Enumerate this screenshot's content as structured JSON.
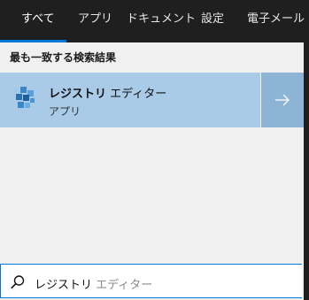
{
  "tabs": [
    {
      "label": "すべて",
      "active": true
    },
    {
      "label": "アプリ"
    },
    {
      "label": "ドキュメント"
    },
    {
      "label": "設定"
    },
    {
      "label": "電子メール"
    }
  ],
  "section_title": "最も一致する検索結果",
  "best_match": {
    "name_bold": "レジストリ",
    "name_rest": " エディター",
    "type": "アプリ",
    "icon": "registry-editor-icon",
    "open_icon": "arrow-right-icon"
  },
  "search": {
    "typed": "レジストリ",
    "suggestion": " エディター",
    "icon": "search-icon"
  },
  "colors": {
    "tabbar_bg": "#1f1f1f",
    "accent": "#0078d7",
    "result_bg": "#a9cbe8",
    "panel_bg": "#f0f0f0"
  }
}
